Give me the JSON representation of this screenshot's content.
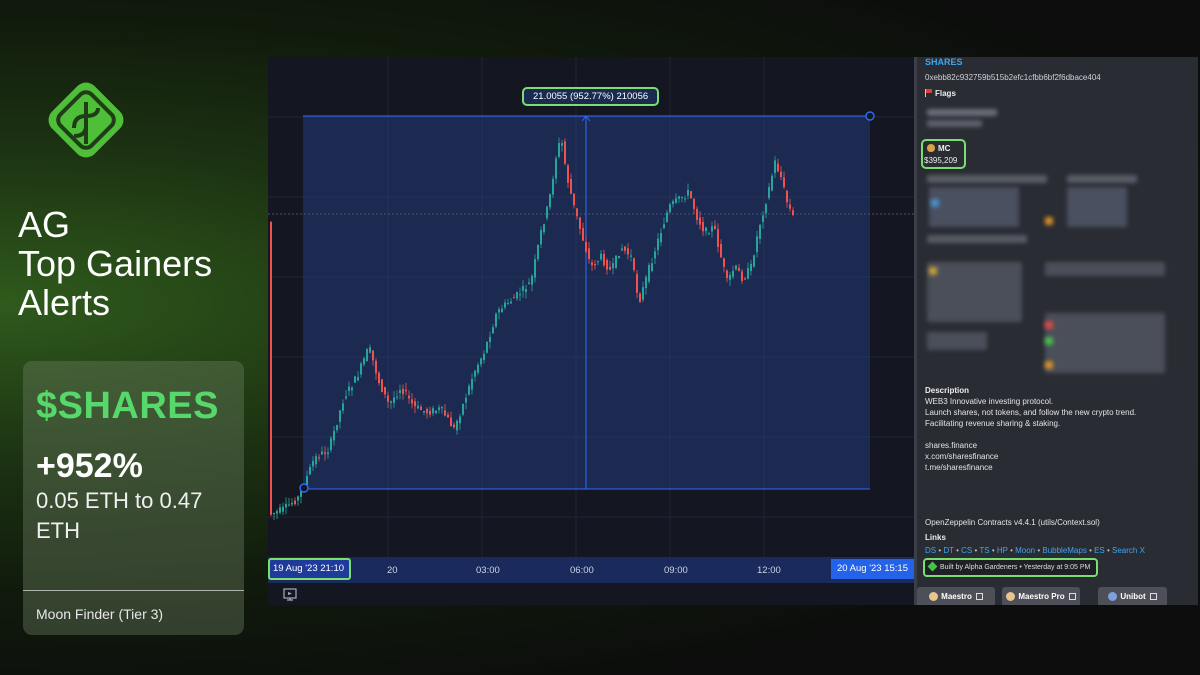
{
  "brand": {
    "logo_icon": "leaf-dollar-icon",
    "title_lines": [
      "AG",
      "Top Gainers",
      "Alerts"
    ],
    "accent_color": "#56d86a"
  },
  "alert": {
    "ticker": "$SHARES",
    "gain": "+952%",
    "from_to": "0.05 ETH to 0.47 ETH",
    "tier": "Moon Finder (Tier 3)"
  },
  "chart": {
    "measure_label": "21.0055 (952.77%) 210056",
    "time_start": "19 Aug '23   21:10",
    "time_ticks": [
      "20",
      "03:00",
      "06:00",
      "09:00",
      "12:00"
    ],
    "time_end": "20 Aug '23   15:15",
    "up_color": "#26a69a",
    "down_color": "#ef5350"
  },
  "info": {
    "token_name": "SHARES",
    "contract": "0xebb82c932759b515b2efc1cfbb6bf2f6dbace404",
    "flags_label": "Flags",
    "mc_label": "MC",
    "mc_value": "$395,209",
    "description_title": "Description",
    "description_lines": [
      "WEB3 Innovative investing protocol.",
      "Launch shares, not tokens, and follow the new crypto trend.",
      "Facilitating revenue sharing & staking."
    ],
    "social_links": [
      "shares.finance",
      "x.com/sharesfinance",
      "t.me/sharesfinance"
    ],
    "contracts_note": "OpenZeppelin Contracts v4.4.1 (utils/Context.sol)",
    "links_title": "Links",
    "links": [
      "DS",
      "DT",
      "CS",
      "TS",
      "HP",
      "Moon",
      "BubbleMaps",
      "ES",
      "Search X"
    ],
    "built_by": "Built by Alpha Gardeners • Yesterday at 9:05 PM",
    "bots": [
      "Maestro",
      "Maestro Pro",
      "Unibot"
    ]
  }
}
